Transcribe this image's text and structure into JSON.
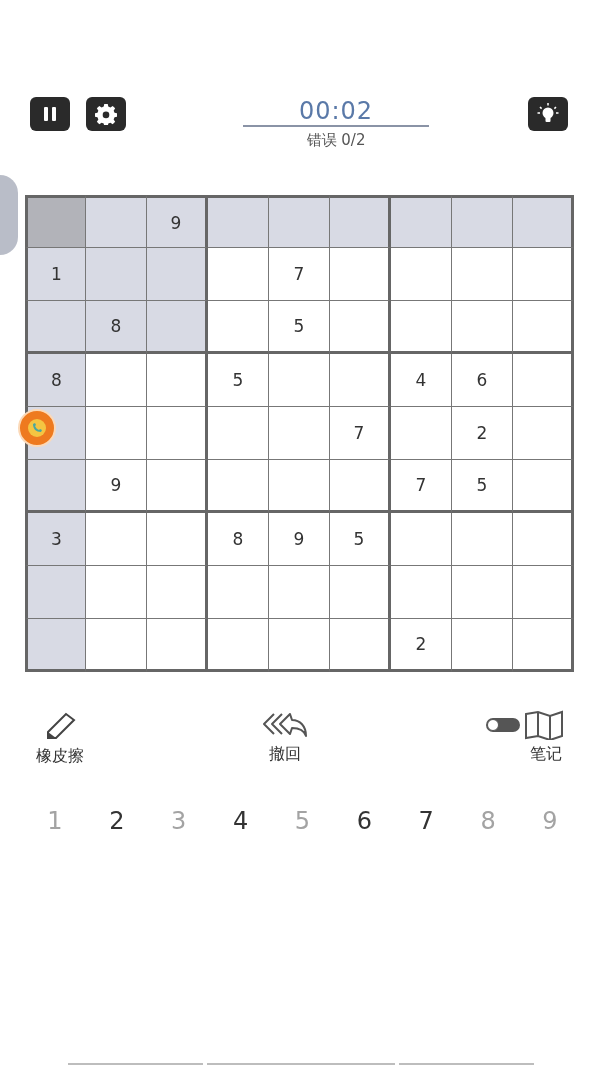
{
  "top_bar": {
    "timer": "00:02",
    "errors_label": "错误 0/2"
  },
  "grid": [
    [
      {
        "selected": true,
        "highlighted": true
      },
      {
        "selected": false,
        "highlighted": true
      },
      {
        "value": "9",
        "selected": false,
        "highlighted": true
      },
      {
        "selected": false,
        "highlighted": true
      },
      {
        "selected": false,
        "highlighted": true
      },
      {
        "selected": false,
        "highlighted": true
      },
      {
        "selected": false,
        "highlighted": true
      },
      {
        "selected": false,
        "highlighted": true
      },
      {
        "selected": false,
        "highlighted": true
      }
    ],
    [
      {
        "value": "1",
        "selected": false,
        "highlighted": true
      },
      {
        "selected": false,
        "highlighted": true
      },
      {
        "selected": false,
        "highlighted": true
      },
      {
        "selected": false,
        "highlighted": false
      },
      {
        "value": "7",
        "selected": false,
        "highlighted": false
      },
      {
        "selected": false,
        "highlighted": false
      },
      {
        "selected": false,
        "highlighted": false
      },
      {
        "selected": false,
        "highlighted": false
      },
      {
        "selected": false,
        "highlighted": false
      }
    ],
    [
      {
        "selected": false,
        "highlighted": true
      },
      {
        "value": "8",
        "selected": false,
        "highlighted": true
      },
      {
        "selected": false,
        "highlighted": true
      },
      {
        "selected": false,
        "highlighted": false
      },
      {
        "value": "5",
        "selected": false,
        "highlighted": false
      },
      {
        "selected": false,
        "highlighted": false
      },
      {
        "selected": false,
        "highlighted": false
      },
      {
        "selected": false,
        "highlighted": false
      },
      {
        "selected": false,
        "highlighted": false
      }
    ],
    [
      {
        "value": "8",
        "selected": false,
        "highlighted": true
      },
      {
        "selected": false,
        "highlighted": false
      },
      {
        "selected": false,
        "highlighted": false
      },
      {
        "value": "5",
        "selected": false,
        "highlighted": false
      },
      {
        "selected": false,
        "highlighted": false
      },
      {
        "selected": false,
        "highlighted": false
      },
      {
        "value": "4",
        "selected": false,
        "highlighted": false
      },
      {
        "value": "6",
        "selected": false,
        "highlighted": false
      },
      {
        "selected": false,
        "highlighted": false
      }
    ],
    [
      {
        "selected": false,
        "highlighted": true
      },
      {
        "selected": false,
        "highlighted": false
      },
      {
        "selected": false,
        "highlighted": false
      },
      {
        "selected": false,
        "highlighted": false
      },
      {
        "selected": false,
        "highlighted": false
      },
      {
        "value": "7",
        "selected": false,
        "highlighted": false
      },
      {
        "selected": false,
        "highlighted": false
      },
      {
        "value": "2",
        "selected": false,
        "highlighted": false
      },
      {
        "selected": false,
        "highlighted": false
      }
    ],
    [
      {
        "selected": false,
        "highlighted": true
      },
      {
        "value": "9",
        "selected": false,
        "highlighted": false
      },
      {
        "selected": false,
        "highlighted": false
      },
      {
        "selected": false,
        "highlighted": false
      },
      {
        "selected": false,
        "highlighted": false
      },
      {
        "selected": false,
        "highlighted": false
      },
      {
        "value": "7",
        "selected": false,
        "highlighted": false
      },
      {
        "value": "5",
        "selected": false,
        "highlighted": false
      },
      {
        "selected": false,
        "highlighted": false
      }
    ],
    [
      {
        "value": "3",
        "selected": false,
        "highlighted": true
      },
      {
        "selected": false,
        "highlighted": false
      },
      {
        "selected": false,
        "highlighted": false
      },
      {
        "value": "8",
        "selected": false,
        "highlighted": false
      },
      {
        "value": "9",
        "selected": false,
        "highlighted": false
      },
      {
        "value": "5",
        "selected": false,
        "highlighted": false
      },
      {
        "selected": false,
        "highlighted": false
      },
      {
        "selected": false,
        "highlighted": false
      },
      {
        "selected": false,
        "highlighted": false
      }
    ],
    [
      {
        "selected": false,
        "highlighted": true
      },
      {
        "selected": false,
        "highlighted": false
      },
      {
        "selected": false,
        "highlighted": false
      },
      {
        "selected": false,
        "highlighted": false
      },
      {
        "selected": false,
        "highlighted": false
      },
      {
        "selected": false,
        "highlighted": false
      },
      {
        "selected": false,
        "highlighted": false
      },
      {
        "selected": false,
        "highlighted": false
      },
      {
        "selected": false,
        "highlighted": false
      }
    ],
    [
      {
        "selected": false,
        "highlighted": true
      },
      {
        "selected": false,
        "highlighted": false
      },
      {
        "selected": false,
        "highlighted": false
      },
      {
        "selected": false,
        "highlighted": false
      },
      {
        "selected": false,
        "highlighted": false
      },
      {
        "selected": false,
        "highlighted": false
      },
      {
        "value": "2",
        "selected": false,
        "highlighted": false
      },
      {
        "selected": false,
        "highlighted": false
      },
      {
        "selected": false,
        "highlighted": false
      }
    ]
  ],
  "tools": [
    {
      "kind": "eraser",
      "label": "橡皮擦"
    },
    {
      "kind": "undo",
      "label": "撤回"
    },
    {
      "kind": "notes",
      "label": "笔记",
      "on": false
    }
  ],
  "number_pad": [
    {
      "digit": "1",
      "dimmed": true
    },
    {
      "digit": "2",
      "dimmed": false
    },
    {
      "digit": "3",
      "dimmed": true
    },
    {
      "digit": "4",
      "dimmed": false
    },
    {
      "digit": "5",
      "dimmed": true
    },
    {
      "digit": "6",
      "dimmed": false
    },
    {
      "digit": "7",
      "dimmed": false
    },
    {
      "digit": "8",
      "dimmed": true
    },
    {
      "digit": "9",
      "dimmed": true
    }
  ]
}
